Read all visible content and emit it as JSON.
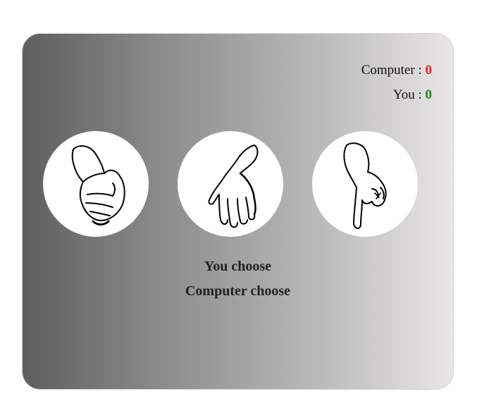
{
  "scoreboard": {
    "computer_label": "Computer : ",
    "computer_score": "0",
    "you_label": "You : ",
    "you_score": "0",
    "computer_score_color": "#ff1a1a",
    "you_score_color": "#1a8a1a"
  },
  "choices": [
    {
      "id": "rock",
      "icon": "fist-hand-icon"
    },
    {
      "id": "paper",
      "icon": "open-hand-icon"
    },
    {
      "id": "scissors",
      "icon": "two-finger-hand-icon"
    }
  ],
  "result": {
    "you_choose": "You choose",
    "computer_choose": "Computer choose"
  }
}
